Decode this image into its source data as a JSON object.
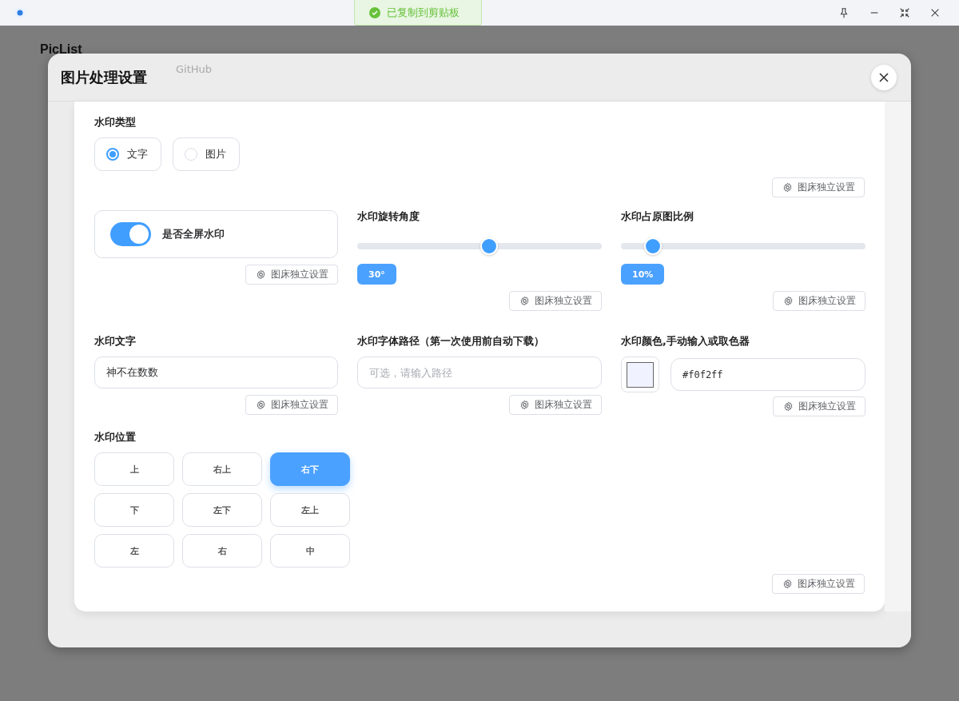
{
  "titlebar": {
    "buttons": [
      {
        "kind": "pin"
      },
      {
        "kind": "minimize"
      },
      {
        "kind": "shrink"
      },
      {
        "kind": "close"
      }
    ]
  },
  "toast": {
    "text": "已复制到剪贴板"
  },
  "app": {
    "title": "PicList",
    "behind_text": "GitHub"
  },
  "dialog": {
    "title": "图片处理设置",
    "watermark_type": {
      "label": "水印类型",
      "options": [
        {
          "label": "文字",
          "selected": true
        },
        {
          "label": "图片",
          "selected": false
        }
      ],
      "setting": "图床独立设置"
    },
    "fullscreen": {
      "label": "是否全屏水印",
      "on": true,
      "setting": "图床独立设置"
    },
    "rotation": {
      "label": "水印旋转角度",
      "level": 0.54,
      "reading": "30°",
      "setting": "图床独立设置"
    },
    "ratio": {
      "label": "水印占原图比例",
      "level": 0.13,
      "reading": "10%",
      "setting": "图床独立设置"
    },
    "text": {
      "label": "水印文字",
      "value": "神不在数数",
      "setting": "图床独立设置"
    },
    "font_path": {
      "label": "水印字体路径（第一次使用前自动下载）",
      "placeholder": "可选，请输入路径",
      "setting": "图床独立设置"
    },
    "color": {
      "label": "水印颜色,手动输入或取色器",
      "value": "#f0f2ff",
      "setting": "图床独立设置"
    },
    "position": {
      "label": "水印位置",
      "options": [
        {
          "label": "上",
          "selected": false
        },
        {
          "label": "右上",
          "selected": false
        },
        {
          "label": "右下",
          "selected": true
        },
        {
          "label": "下",
          "selected": false
        },
        {
          "label": "左下",
          "selected": false
        },
        {
          "label": "左上",
          "selected": false
        },
        {
          "label": "左",
          "selected": false
        },
        {
          "label": "右",
          "selected": false
        },
        {
          "label": "中",
          "selected": false
        }
      ],
      "setting": "图床独立设置"
    }
  }
}
